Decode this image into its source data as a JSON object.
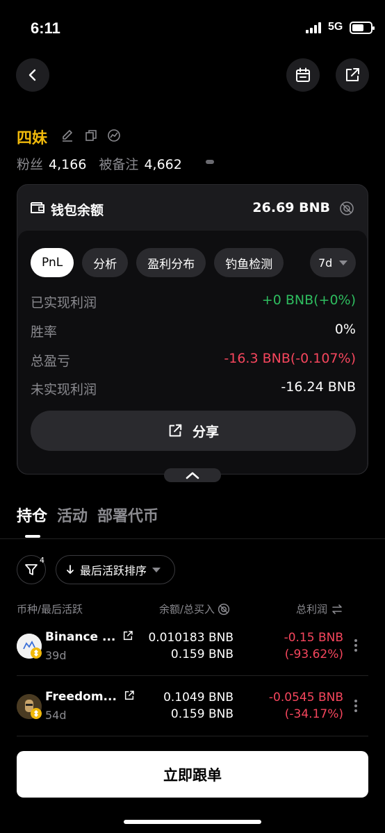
{
  "status_bar": {
    "time": "6:11",
    "network": "5G"
  },
  "profile": {
    "name": "四妹",
    "followers_label": "粉丝",
    "followers_value": "4,166",
    "noted_label": "被备注",
    "noted_value": "4,662"
  },
  "wallet": {
    "title": "钱包余额",
    "balance": "26.69 BNB",
    "chips": [
      "PnL",
      "分析",
      "盈利分布",
      "钓鱼检测"
    ],
    "period": "7d",
    "rows": [
      {
        "label": "已实现利润",
        "value": "+0 BNB(+0%)",
        "tone": "green"
      },
      {
        "label": "胜率",
        "value": "0%",
        "tone": "white"
      },
      {
        "label": "总盈亏",
        "value": "-16.3 BNB(-0.107%)",
        "tone": "red"
      },
      {
        "label": "未实现利润",
        "value": "-16.24 BNB",
        "tone": "white"
      }
    ],
    "share_label": "分享"
  },
  "tabs": [
    "持仓",
    "活动",
    "部署代币"
  ],
  "filters": {
    "filter_count": "4",
    "sort_label": "最后活跃排序"
  },
  "columns": {
    "token": "币种/最后活跃",
    "balance": "余额/总买入",
    "pnl": "总利润"
  },
  "holdings": [
    {
      "name": "Binance ...",
      "age": "39d",
      "balance": "0.010183 BNB",
      "bought": "0.159 BNB",
      "pnl": "-0.15 BNB",
      "pnl_pct": "(-93.62%)"
    },
    {
      "name": "Freedom...",
      "age": "54d",
      "balance": "0.1049 BNB",
      "bought": "0.159 BNB",
      "pnl": "-0.0545 BNB",
      "pnl_pct": "(-34.17%)"
    }
  ],
  "follow_button": "立即跟单",
  "colors": {
    "accent_gold": "#f0b90b",
    "gain": "#2ebd5f",
    "loss": "#f6465d"
  }
}
